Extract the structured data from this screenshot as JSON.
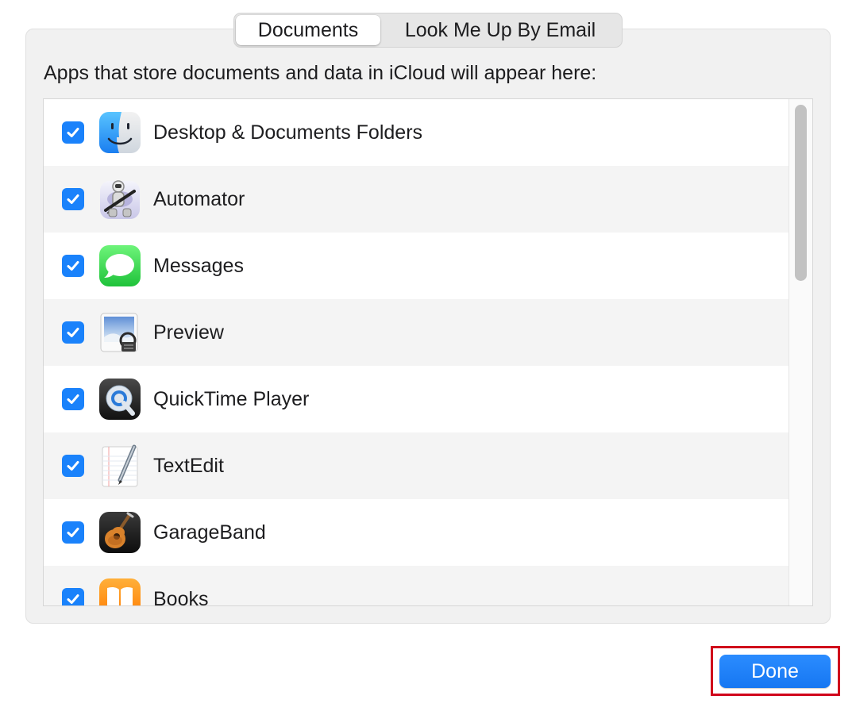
{
  "tabs": [
    {
      "label": "Documents",
      "selected": true
    },
    {
      "label": "Look Me Up By Email",
      "selected": false
    }
  ],
  "description": "Apps that store documents and data in iCloud will appear here:",
  "apps": [
    {
      "name": "Desktop & Documents Folders",
      "checked": true,
      "icon": "finder-icon"
    },
    {
      "name": "Automator",
      "checked": true,
      "icon": "automator-icon"
    },
    {
      "name": "Messages",
      "checked": true,
      "icon": "messages-icon"
    },
    {
      "name": "Preview",
      "checked": true,
      "icon": "preview-icon"
    },
    {
      "name": "QuickTime Player",
      "checked": true,
      "icon": "quicktime-icon"
    },
    {
      "name": "TextEdit",
      "checked": true,
      "icon": "textedit-icon"
    },
    {
      "name": "GarageBand",
      "checked": true,
      "icon": "garageband-icon"
    },
    {
      "name": "Books",
      "checked": true,
      "icon": "books-icon"
    }
  ],
  "done_label": "Done",
  "colors": {
    "accent": "#1a82fb",
    "highlight": "#d0021b"
  }
}
